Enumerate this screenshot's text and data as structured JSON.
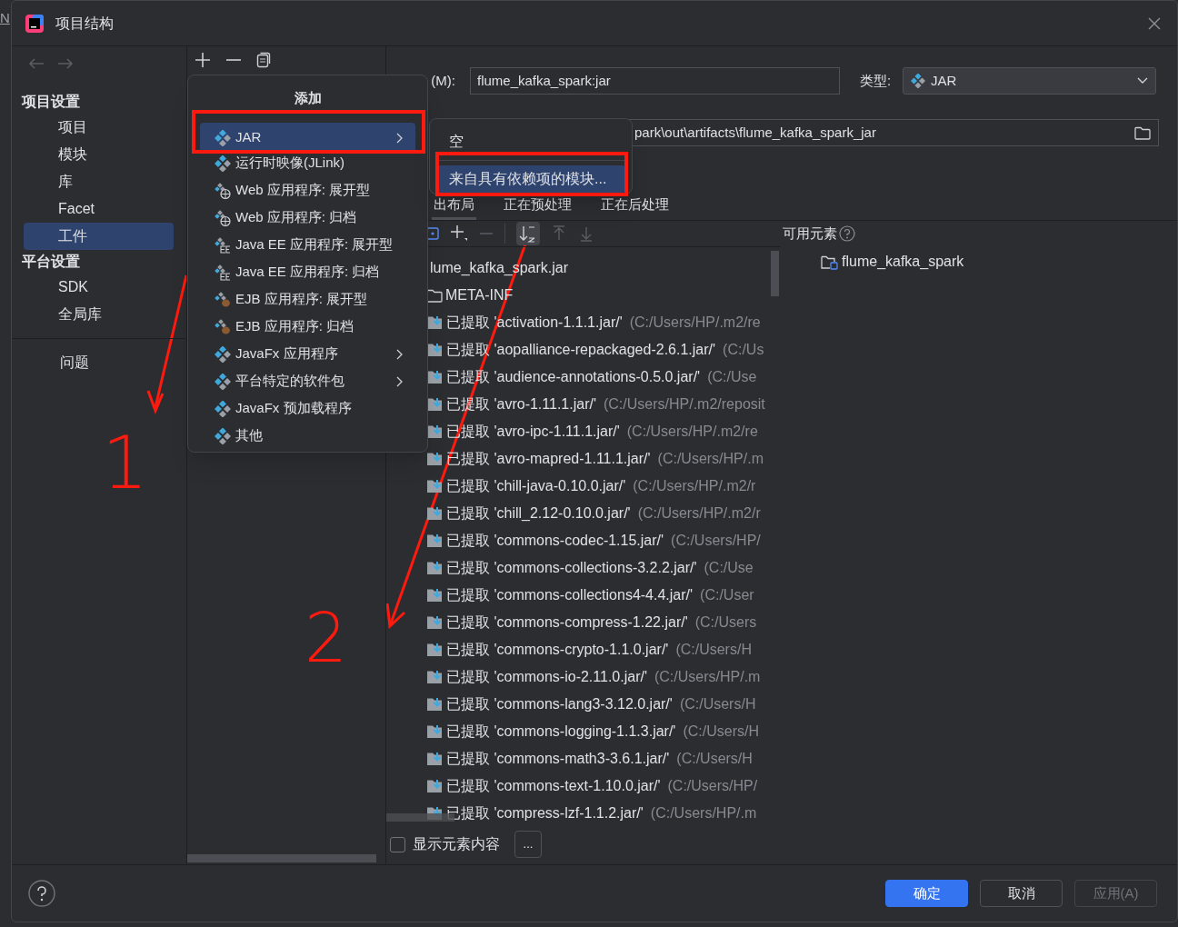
{
  "background_ide": {
    "text": "N"
  },
  "window": {
    "title": "项目结构"
  },
  "sidebar": {
    "sections": [
      {
        "title": "项目设置",
        "items": [
          {
            "label": "项目",
            "selected": false
          },
          {
            "label": "模块",
            "selected": false
          },
          {
            "label": "库",
            "selected": false
          },
          {
            "label": "Facet",
            "selected": false
          },
          {
            "label": "工件",
            "selected": true
          }
        ]
      },
      {
        "title": "平台设置",
        "items": [
          {
            "label": "SDK",
            "selected": false
          },
          {
            "label": "全局库",
            "selected": false
          }
        ]
      }
    ],
    "extra_items": [
      {
        "label": "问题",
        "selected": false
      }
    ]
  },
  "artifact": {
    "name_label": "(M):",
    "name": "flume_kafka_spark:jar",
    "type_label": "类型:",
    "type": "JAR",
    "output_dir": "park\\out\\artifacts\\flume_kafka_spark_jar"
  },
  "tabs": [
    {
      "label": "出布局",
      "selected": true
    },
    {
      "label": "正在预处理",
      "selected": false
    },
    {
      "label": "正在后处理",
      "selected": false
    }
  ],
  "layout_tree": [
    {
      "label": "lume_kafka_spark.jar",
      "children": [
        {
          "kind": "folder",
          "label": "META-INF"
        },
        {
          "kind": "extracted",
          "label": "已提取 'activation-1.1.1.jar/'",
          "path": "(C:/Users/HP/.m2/re"
        },
        {
          "kind": "extracted",
          "label": "已提取 'aopalliance-repackaged-2.6.1.jar/'",
          "path": "(C:/Us"
        },
        {
          "kind": "extracted",
          "label": "已提取 'audience-annotations-0.5.0.jar/'",
          "path": "(C:/Use"
        },
        {
          "kind": "extracted",
          "label": "已提取 'avro-1.11.1.jar/'",
          "path": "(C:/Users/HP/.m2/reposit"
        },
        {
          "kind": "extracted",
          "label": "已提取 'avro-ipc-1.11.1.jar/'",
          "path": "(C:/Users/HP/.m2/re"
        },
        {
          "kind": "extracted",
          "label": "已提取 'avro-mapred-1.11.1.jar/'",
          "path": "(C:/Users/HP/.m"
        },
        {
          "kind": "extracted",
          "label": "已提取 'chill-java-0.10.0.jar/'",
          "path": "(C:/Users/HP/.m2/r"
        },
        {
          "kind": "extracted",
          "label": "已提取 'chill_2.12-0.10.0.jar/'",
          "path": "(C:/Users/HP/.m2/r"
        },
        {
          "kind": "extracted",
          "label": "已提取 'commons-codec-1.15.jar/'",
          "path": "(C:/Users/HP/"
        },
        {
          "kind": "extracted",
          "label": "已提取 'commons-collections-3.2.2.jar/'",
          "path": "(C:/Use"
        },
        {
          "kind": "extracted",
          "label": "已提取 'commons-collections4-4.4.jar/'",
          "path": "(C:/User"
        },
        {
          "kind": "extracted",
          "label": "已提取 'commons-compress-1.22.jar/'",
          "path": "(C:/Users"
        },
        {
          "kind": "extracted",
          "label": "已提取 'commons-crypto-1.1.0.jar/'",
          "path": "(C:/Users/H"
        },
        {
          "kind": "extracted",
          "label": "已提取 'commons-io-2.11.0.jar/'",
          "path": "(C:/Users/HP/.m"
        },
        {
          "kind": "extracted",
          "label": "已提取 'commons-lang3-3.12.0.jar/'",
          "path": "(C:/Users/H"
        },
        {
          "kind": "extracted",
          "label": "已提取 'commons-logging-1.1.3.jar/'",
          "path": "(C:/Users/H"
        },
        {
          "kind": "extracted",
          "label": "已提取 'commons-math3-3.6.1.jar/'",
          "path": "(C:/Users/H"
        },
        {
          "kind": "extracted",
          "label": "已提取 'commons-text-1.10.0.jar/'",
          "path": "(C:/Users/HP/"
        },
        {
          "kind": "extracted",
          "label": "已提取 'compress-lzf-1.1.2.jar/'",
          "path": "(C:/Users/HP/.m"
        }
      ]
    }
  ],
  "available": {
    "title": "可用元素",
    "items": [
      {
        "label": "flume_kafka_spark"
      }
    ]
  },
  "show_content": {
    "label": "显示元素内容",
    "checked": false
  },
  "more_button": "...",
  "buttons": [
    {
      "label": "确定",
      "kind": "primary"
    },
    {
      "label": "取消",
      "kind": "normal"
    },
    {
      "label": "应用(A)",
      "kind": "disabled"
    }
  ],
  "add_menu": {
    "title": "添加",
    "items": [
      {
        "kind": "jar",
        "label": "JAR",
        "submenu": true,
        "selected": true
      },
      {
        "kind": "jar",
        "label": "运行时映像(JLink)",
        "submenu": false,
        "selected": false
      },
      {
        "kind": "web",
        "label": "Web 应用程序: 展开型",
        "submenu": false,
        "selected": false
      },
      {
        "kind": "web",
        "label": "Web 应用程序: 归档",
        "submenu": false,
        "selected": false
      },
      {
        "kind": "javaee",
        "label": "Java EE 应用程序: 展开型",
        "submenu": false,
        "selected": false
      },
      {
        "kind": "javaee",
        "label": "Java EE 应用程序: 归档",
        "submenu": false,
        "selected": false
      },
      {
        "kind": "ejb",
        "label": "EJB 应用程序: 展开型",
        "submenu": false,
        "selected": false
      },
      {
        "kind": "ejb",
        "label": "EJB 应用程序: 归档",
        "submenu": false,
        "selected": false
      },
      {
        "kind": "jar",
        "label": "JavaFx 应用程序",
        "submenu": true,
        "selected": false
      },
      {
        "kind": "jar",
        "label": "平台特定的软件包",
        "submenu": true,
        "selected": false
      },
      {
        "kind": "jar",
        "label": "JavaFx 预加载程序",
        "submenu": false,
        "selected": false
      },
      {
        "kind": "jar",
        "label": "其他",
        "submenu": false,
        "selected": false
      }
    ]
  },
  "submenu": {
    "items": [
      {
        "label": "空",
        "selected": false
      },
      {
        "label": "来自具有依赖项的模块...",
        "selected": true
      }
    ]
  },
  "annotations": {
    "marks": [
      "1",
      "2"
    ]
  }
}
